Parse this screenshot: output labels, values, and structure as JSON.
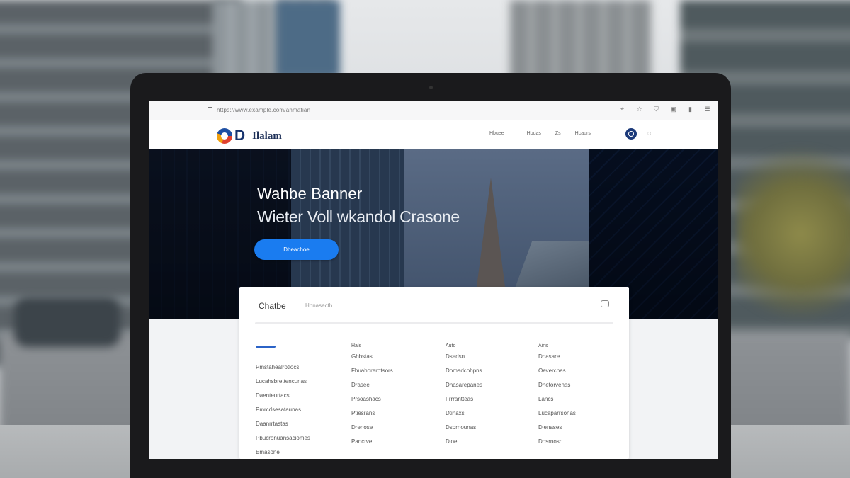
{
  "browser": {
    "url": "https://www.example.com/ahmatian",
    "icons": [
      "pin-icon",
      "star-icon",
      "shield-icon",
      "extension-icon",
      "bookmark-icon",
      "menu-icon"
    ]
  },
  "site": {
    "logo_letter": "D",
    "brand": "Ilalam",
    "nav": [
      "Hbuee",
      "Hodas",
      "Zs",
      "Hcaurs"
    ]
  },
  "hero": {
    "title": "Wahbe Banner",
    "subtitle": "Wieter Voll wkandol Crasone",
    "cta": "Dbeachoe"
  },
  "card": {
    "title": "Chatbe",
    "breadcrumb": "Hnnasecth"
  },
  "columns": [
    {
      "head": "",
      "items": [
        "Pmstahealrotlocs",
        "Lucahsbrettencunas",
        "Daenteurtacs",
        "Pmrcdsesataunas",
        "Daanrrtastas",
        "Pbucronuansaciomes",
        "Emasone"
      ]
    },
    {
      "head": "Hals",
      "items": [
        "Ghbstas",
        "Fhuahorerotsors",
        "Drasee",
        "Prsoashacs",
        "Ptiesrans",
        "Drenose",
        "Pancrve"
      ]
    },
    {
      "head": "Auto",
      "items": [
        "Dsedsn",
        "Domadcohpns",
        "Dnasarepanes",
        "Frrrantteas",
        "Dtinaxs",
        "Dsornounas",
        "Dloe"
      ]
    },
    {
      "head": "Ains",
      "items": [
        "Dnasare",
        "Oevercnas",
        "Dnetorvenas",
        "Lancs",
        "Lucaparrsonas",
        "Dlenases",
        "Dosrnosr"
      ]
    }
  ]
}
